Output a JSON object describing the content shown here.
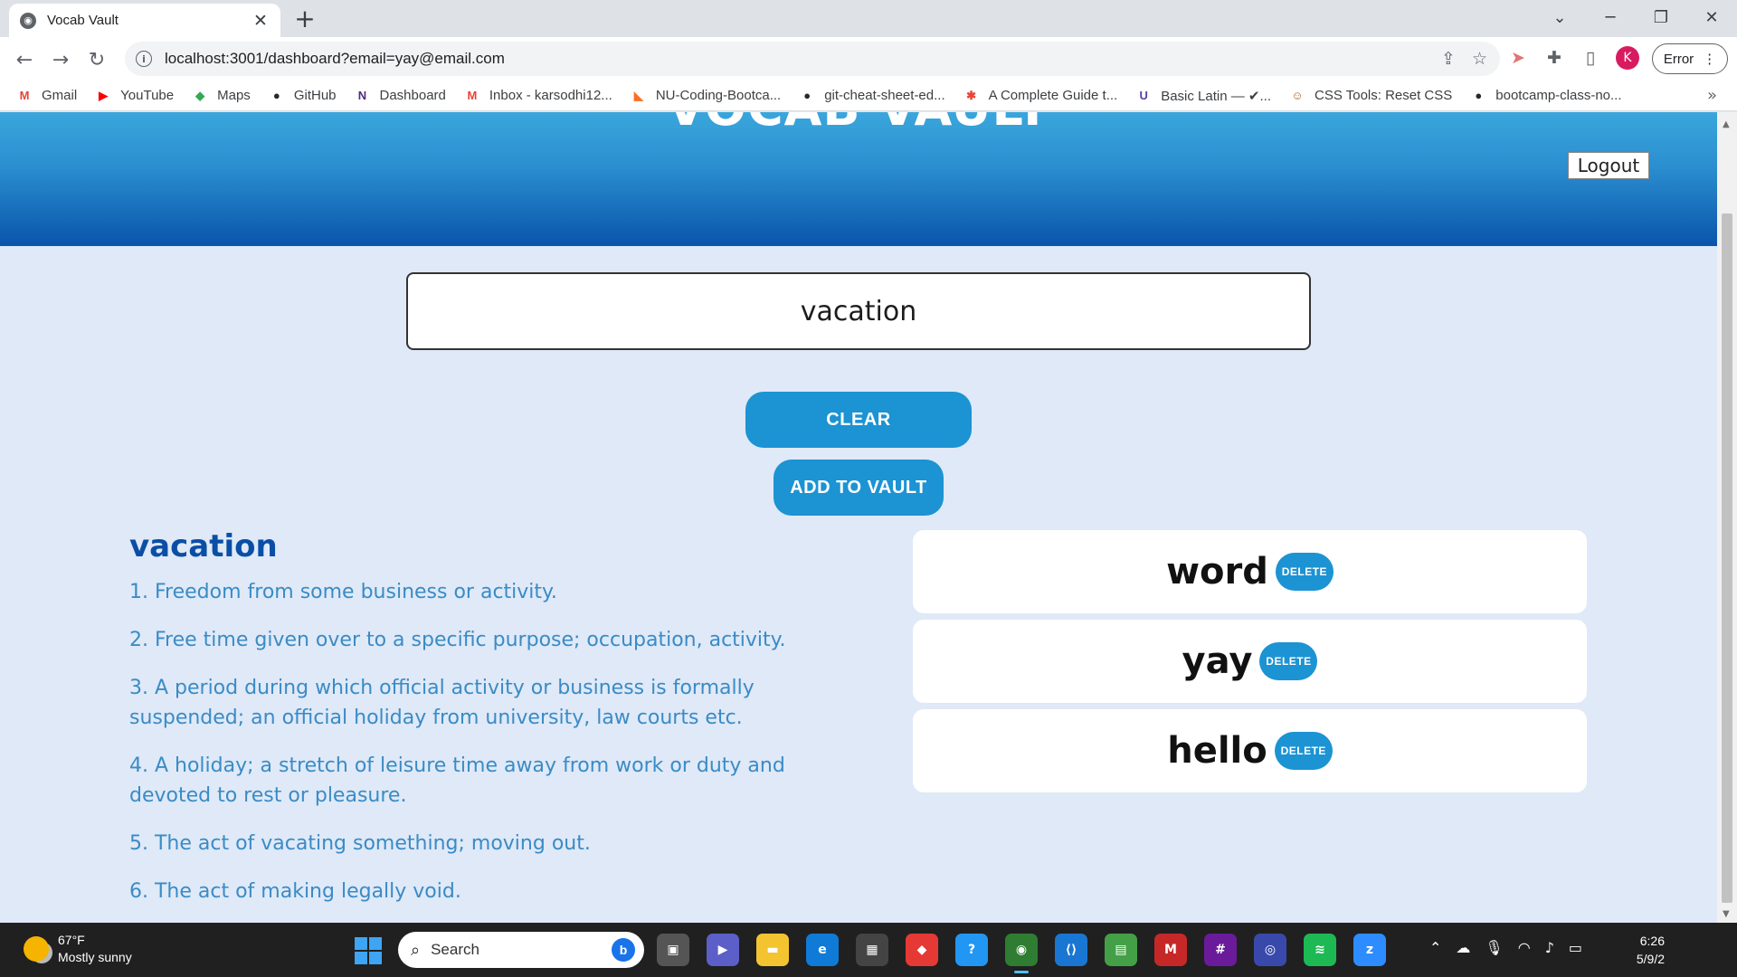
{
  "browser": {
    "tab_title": "Vocab Vault",
    "url": "localhost:3001/dashboard?email=yay@email.com",
    "profile_initial": "K",
    "error_label": "Error",
    "bookmarks": [
      {
        "label": "Gmail",
        "icon": "gmail-icon",
        "glyph": "M",
        "color": "#ea4335"
      },
      {
        "label": "YouTube",
        "icon": "youtube-icon",
        "glyph": "▶",
        "color": "#ff0000"
      },
      {
        "label": "Maps",
        "icon": "maps-icon",
        "glyph": "◆",
        "color": "#34a853"
      },
      {
        "label": "GitHub",
        "icon": "github-icon",
        "glyph": "●",
        "color": "#24292e"
      },
      {
        "label": "Dashboard",
        "icon": "northwestern-icon",
        "glyph": "N",
        "color": "#4e2a84"
      },
      {
        "label": "Inbox - karsodhi12...",
        "icon": "gmail-icon",
        "glyph": "M",
        "color": "#ea4335"
      },
      {
        "label": "NU-Coding-Bootca...",
        "icon": "gitlab-icon",
        "glyph": "◣",
        "color": "#fc6d26"
      },
      {
        "label": "git-cheat-sheet-ed...",
        "icon": "github-icon",
        "glyph": "●",
        "color": "#24292e"
      },
      {
        "label": "A Complete Guide t...",
        "icon": "csstricks-icon",
        "glyph": "✱",
        "color": "#e8453c"
      },
      {
        "label": "Basic Latin — ✔...",
        "icon": "unicode-table-icon",
        "glyph": "U",
        "color": "#5b3fa0"
      },
      {
        "label": "CSS Tools: Reset CSS",
        "icon": "meyerweb-icon",
        "glyph": "☺",
        "color": "#b5651d"
      },
      {
        "label": "bootcamp-class-no...",
        "icon": "github-icon",
        "glyph": "●",
        "color": "#24292e"
      }
    ]
  },
  "app": {
    "title": "VOCAB VAULT",
    "logout_label": "Logout",
    "search_value": "vacation",
    "clear_label": "CLEAR",
    "add_label": "ADD TO VAULT",
    "definition": {
      "word": "vacation",
      "items": [
        "1. Freedom from some business or activity.",
        "2. Free time given over to a specific purpose; occupation, activity.",
        "3. A period during which official activity or business is formally suspended; an official holiday from university, law courts etc.",
        "4. A holiday; a stretch of leisure time away from work or duty and devoted to rest or pleasure.",
        "5. The act of vacating something; moving out.",
        "6. The act of making legally void."
      ]
    },
    "vault": [
      {
        "word": "word",
        "delete_label": "DELETE"
      },
      {
        "word": "yay",
        "delete_label": "DELETE"
      },
      {
        "word": "hello",
        "delete_label": "DELETE"
      }
    ],
    "accent_color": "#1c93d3",
    "heading_color": "#0a4ea6"
  },
  "taskbar": {
    "temperature": "67°F",
    "weather": "Mostly sunny",
    "search_placeholder": "Search",
    "time": "6:26",
    "date": "5/9/2"
  }
}
